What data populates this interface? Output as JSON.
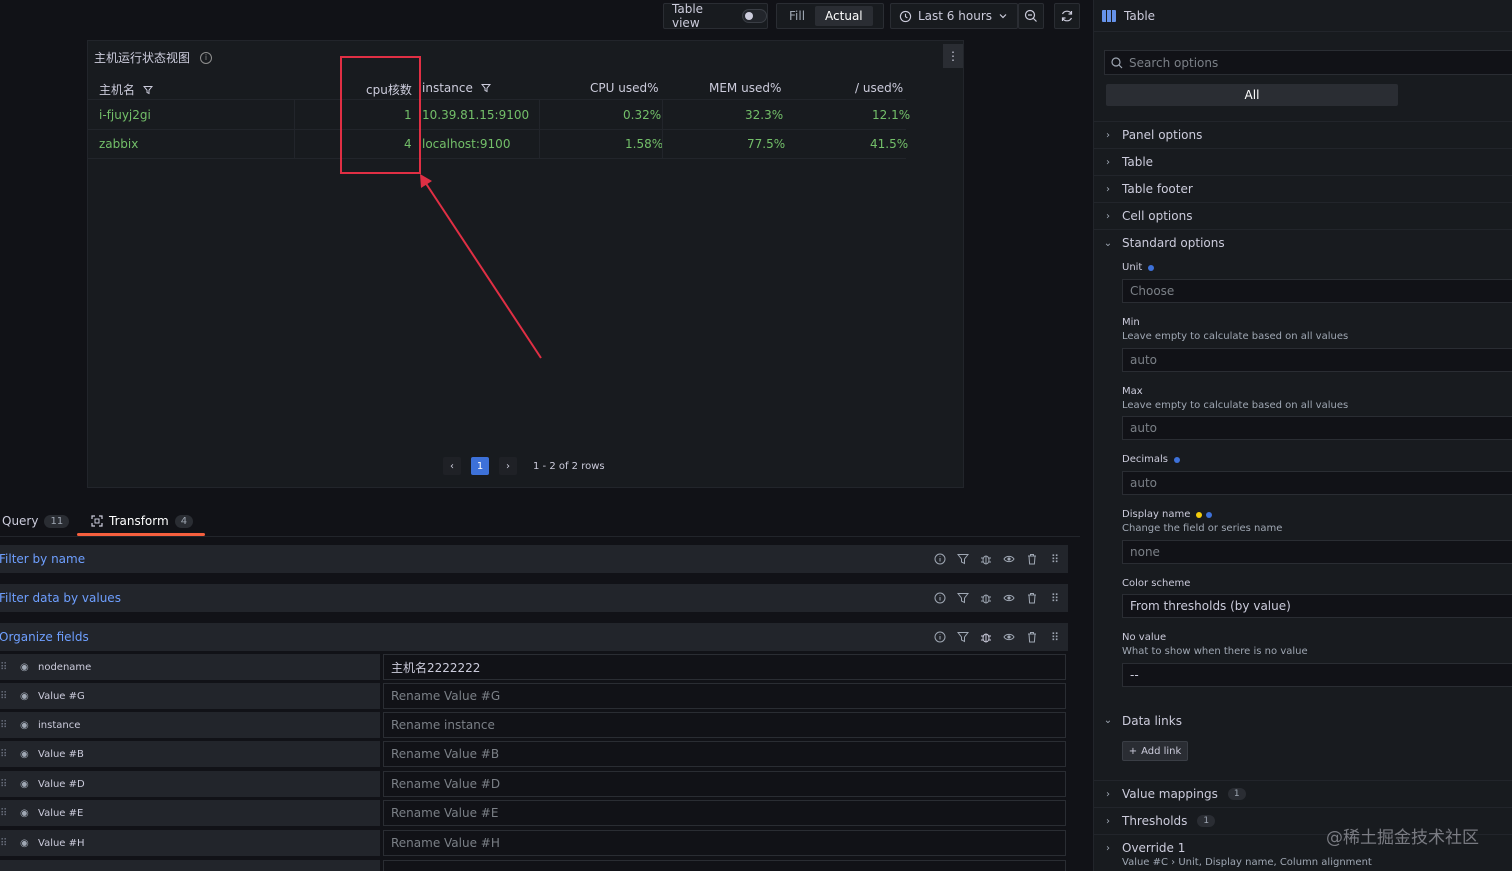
{
  "toolbar": {
    "table_view_label": "Table view",
    "fill_label": "Fill",
    "actual_label": "Actual",
    "time_range": "Last 6 hours"
  },
  "panel": {
    "title": "主机运行状态视图",
    "columns": [
      "主机名",
      "cpu核数",
      "instance",
      "CPU used%",
      "MEM used%",
      "/ used%"
    ],
    "rows": [
      [
        "i-fjuyj2gi",
        "1",
        "10.39.81.15:9100",
        "0.32%",
        "32.3%",
        "12.1%"
      ],
      [
        "zabbix",
        "4",
        "localhost:9100",
        "1.58%",
        "77.5%",
        "41.5%"
      ]
    ],
    "page": "1",
    "rows_summary": "1 - 2 of 2 rows",
    "value_color": "#73bf69",
    "highlight_color": "#e02f44"
  },
  "tabs": {
    "query_label": "Query",
    "query_count": "11",
    "transform_label": "Transform",
    "transform_count": "4"
  },
  "transforms": {
    "filter_by_name": "Filter by name",
    "filter_by_values": "Filter data by values",
    "organize_fields": "Organize fields",
    "fields": [
      {
        "name": "nodename",
        "value": "主机名2222222",
        "placeholder": ""
      },
      {
        "name": "Value #G",
        "value": "",
        "placeholder": "Rename Value #G"
      },
      {
        "name": "instance",
        "value": "",
        "placeholder": "Rename instance"
      },
      {
        "name": "Value #B",
        "value": "",
        "placeholder": "Rename Value #B"
      },
      {
        "name": "Value #D",
        "value": "",
        "placeholder": "Rename Value #D"
      },
      {
        "name": "Value #E",
        "value": "",
        "placeholder": "Rename Value #E"
      },
      {
        "name": "Value #H",
        "value": "",
        "placeholder": "Rename Value #H"
      }
    ]
  },
  "options": {
    "header_title": "Table",
    "search_placeholder": "Search options",
    "all_label": "All",
    "sections": {
      "panel_options": "Panel options",
      "table": "Table",
      "table_footer": "Table footer",
      "cell_options": "Cell options",
      "standard_options": "Standard options",
      "data_links": "Data links",
      "value_mappings": "Value mappings",
      "value_mappings_count": "1",
      "thresholds": "Thresholds",
      "thresholds_count": "1",
      "override": "Override 1"
    },
    "unit": {
      "label": "Unit",
      "placeholder": "Choose"
    },
    "min": {
      "label": "Min",
      "desc": "Leave empty to calculate based on all values",
      "placeholder": "auto"
    },
    "max": {
      "label": "Max",
      "desc": "Leave empty to calculate based on all values",
      "placeholder": "auto"
    },
    "decimals": {
      "label": "Decimals",
      "placeholder": "auto"
    },
    "display_name": {
      "label": "Display name",
      "desc": "Change the field or series name",
      "placeholder": "none"
    },
    "color_scheme": {
      "label": "Color scheme",
      "value": "From thresholds (by value)"
    },
    "no_value": {
      "label": "No value",
      "desc": "What to show when there is no value",
      "placeholder": "--"
    },
    "add_link_label": "Add link",
    "override_sub": "Value #C  ›  Unit, Display name, Column alignment",
    "dot_blue": "#3d71d9",
    "dot_yellow": "#f2cc0c"
  },
  "watermark": "@稀土掘金技术社区"
}
